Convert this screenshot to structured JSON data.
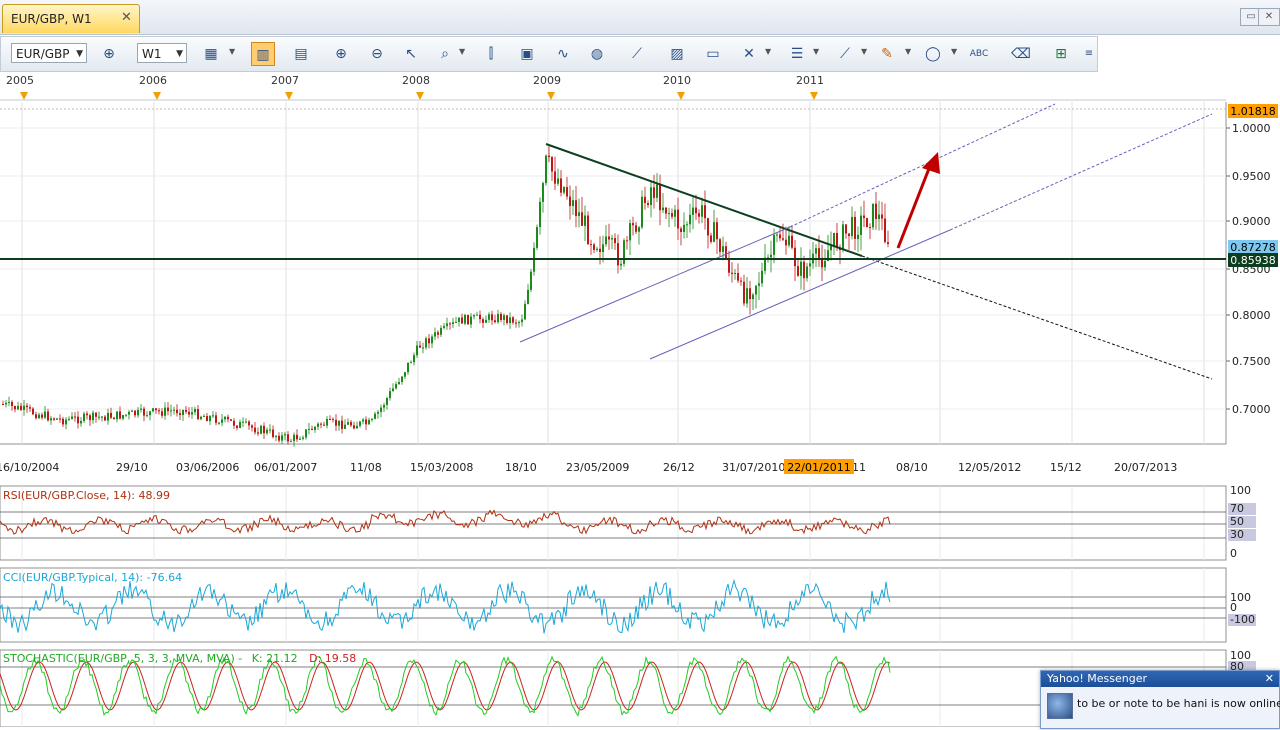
{
  "tab": {
    "title": "EUR/GBP, W1",
    "close": "✕"
  },
  "window_controls": {
    "restore": "▭",
    "close": "✕"
  },
  "toolbar": {
    "symbol": "EUR/GBP",
    "timeframe": "W1",
    "icons": [
      "crosshair-icon",
      "bar-chart-icon",
      "candlestick-icon",
      "line-chart-icon",
      "zoom-in-icon",
      "zoom-out-icon",
      "cursor-icon",
      "text-zoom-icon",
      "indicator-icon",
      "template-icon",
      "wave-icon",
      "globe-icon",
      "ruler-icon",
      "image-icon",
      "window-icon",
      "tools-icon",
      "channel-icon",
      "fibonacci-icon",
      "pencil-icon",
      "ellipse-icon",
      "abc-text-icon",
      "eraser-icon",
      "hierarchy-icon",
      "more-icon"
    ]
  },
  "main_chart": {
    "years": [
      "2005",
      "2006",
      "2007",
      "2008",
      "2009",
      "2010",
      "2011"
    ],
    "date_ticks": [
      "16/10/2004",
      "29/10",
      "03/06/2006",
      "06/01/2007",
      "11/08",
      "15/03/2008",
      "18/10",
      "23/05/2009",
      "26/12",
      "31/07/2010",
      "11",
      "08/10",
      "12/05/2012",
      "15/12",
      "20/07/2013"
    ],
    "highlight_date": "22/01/2011",
    "price_ticks": [
      "1.0000",
      "0.9500",
      "0.9000",
      "0.8500",
      "0.8000",
      "0.7500",
      "0.7000"
    ],
    "price_labels": {
      "top": "1.01818",
      "current": "0.87278",
      "support": "0.85938"
    },
    "colors": {
      "highlight": "#ffa000",
      "current": "#7ec8f0",
      "support": "#0b3d1e",
      "arrow": "#c00000",
      "up": "#1a8c1a",
      "down": "#c01818"
    }
  },
  "rsi": {
    "label": "RSI(EUR/GBP.Close, 14): 48.99",
    "levels": [
      "100",
      "70",
      "50",
      "30",
      "0"
    ],
    "color": "#b03010"
  },
  "cci": {
    "label": "CCI(EUR/GBP.Typical, 14): -76.64",
    "levels": [
      "100",
      "0",
      "-100"
    ],
    "color": "#19a8d8"
  },
  "stochastic": {
    "label": "STOCHASTIC(EUR/GBP, 5, 3, 3, MVA, MVA) -",
    "k": "K: 21.12",
    "d": "D: 19.58",
    "levels": [
      "100",
      "80"
    ],
    "k_color": "#22cc22",
    "d_color": "#cc2222"
  },
  "messenger": {
    "title": "Yahoo! Messenger",
    "message": "to be or note to be hani is now online",
    "close": "✕"
  }
}
